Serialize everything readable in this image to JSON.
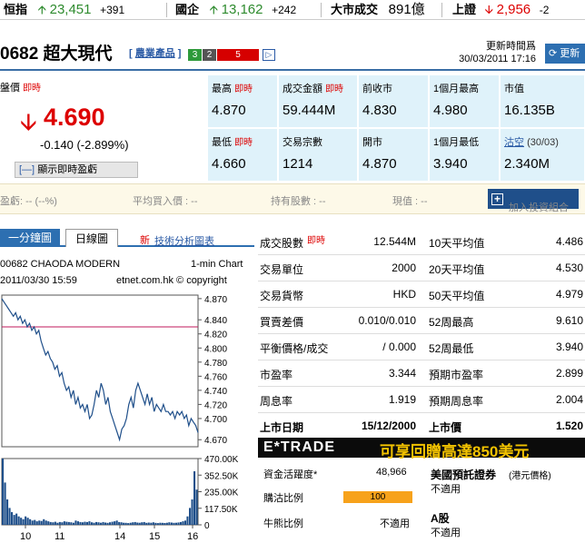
{
  "ticker": [
    {
      "name": "恒指",
      "value": "23,451",
      "change": "+391",
      "dir": "up"
    },
    {
      "name": "國企",
      "value": "13,162",
      "change": "+242",
      "dir": "up"
    },
    {
      "name": "大市成交",
      "value": "891億",
      "change": "",
      "dir": "none"
    },
    {
      "name": "上證",
      "value": "2,956",
      "change": "-2",
      "dir": "down"
    }
  ],
  "header": {
    "code_name": "0682 超大現代",
    "sector": "農業產品",
    "ratings": [
      "3",
      "2",
      "5"
    ],
    "rating_colors": [
      "#2e9a3a",
      "#555555",
      "#d60000"
    ],
    "update_label": "更新時間爲",
    "update_time": "30/03/2011 17:16",
    "refresh_label": "更新"
  },
  "quote": {
    "price_label": "盤價",
    "realtime": "即時",
    "price": "4.690",
    "change": "-0.140 (-2.899%)",
    "show_pnl": "顯示即時盈虧"
  },
  "cells": [
    {
      "label": "最高",
      "rt": "即時",
      "value": "4.870"
    },
    {
      "label": "成交金額",
      "rt": "即時",
      "value": "59.444M"
    },
    {
      "label": "前收市",
      "rt": "",
      "value": "4.830"
    },
    {
      "label": "1個月最高",
      "rt": "",
      "value": "4.980"
    },
    {
      "label": "市值",
      "rt": "",
      "value": "16.135B"
    },
    {
      "label": "最低",
      "rt": "即時",
      "value": "4.660"
    },
    {
      "label": "交易宗數",
      "rt": "",
      "value": "1214"
    },
    {
      "label": "開市",
      "rt": "",
      "value": "4.870"
    },
    {
      "label": "1個月最低",
      "rt": "",
      "value": "3.940"
    },
    {
      "label": "沽空",
      "rt": "(30/03)",
      "value": "2.340M"
    }
  ],
  "portfolio": {
    "pnl": "盈虧: -- (--%)",
    "avg": "平均買入價 : --",
    "shares": "持有股數 : --",
    "cash": "現值 : --",
    "add_label": "加入投資組合"
  },
  "chart": {
    "tab1": "一分鐘圖",
    "tab2": "日線圖",
    "new": "新",
    "analysis": "技術分析圖表",
    "title": "00682 CHAODA MODERN",
    "interval": "1-min Chart",
    "datetime": "2011/03/30 15:59",
    "copyright": "etnet.com.hk © copyright",
    "price_ticks": [
      "4.870",
      "4.840",
      "4.820",
      "4.800",
      "4.780",
      "4.760",
      "4.740",
      "4.720",
      "4.700",
      "4.670"
    ],
    "vol_ticks": [
      "470.00K",
      "352.50K",
      "235.00K",
      "117.50K",
      "0"
    ],
    "x_ticks": [
      "10",
      "11",
      "14",
      "15",
      "16"
    ]
  },
  "chart_data": {
    "type": "line",
    "x_ticks": [
      "10",
      "11",
      "14",
      "15",
      "16"
    ],
    "ylim": [
      4.66,
      4.875
    ],
    "ref_line": 4.83,
    "price": [
      4.87,
      4.865,
      4.86,
      4.855,
      4.85,
      4.845,
      4.85,
      4.84,
      4.845,
      4.835,
      4.84,
      4.83,
      4.835,
      4.825,
      4.83,
      4.82,
      4.825,
      4.81,
      4.8,
      4.79,
      4.795,
      4.785,
      4.78,
      4.77,
      4.775,
      4.76,
      4.765,
      4.75,
      4.74,
      4.745,
      4.73,
      4.74,
      4.72,
      4.73,
      4.715,
      4.72,
      4.71,
      4.72,
      4.7,
      4.705,
      4.72,
      4.74,
      4.73,
      4.75,
      4.74,
      4.72,
      4.73,
      4.71,
      4.7,
      4.69,
      4.68,
      4.67,
      4.685,
      4.69,
      4.7,
      4.72,
      4.73,
      4.715,
      4.74,
      4.75,
      4.74,
      4.73,
      4.72,
      4.735,
      4.72,
      4.73,
      4.71,
      4.72,
      4.715,
      4.71,
      4.72,
      4.71,
      4.71,
      4.705,
      4.71,
      4.7,
      4.71,
      4.705,
      4.71,
      4.7,
      4.705,
      4.69,
      4.7,
      4.695,
      4.69,
      4.68
    ],
    "volume": [
      470,
      300,
      180,
      120,
      90,
      70,
      80,
      60,
      50,
      40,
      60,
      50,
      40,
      30,
      35,
      25,
      30,
      28,
      40,
      30,
      25,
      20,
      18,
      22,
      15,
      20,
      18,
      25,
      22,
      20,
      18,
      15,
      30,
      25,
      20,
      18,
      22,
      20,
      25,
      18,
      15,
      20,
      18,
      15,
      20,
      16,
      14,
      18,
      22,
      25,
      30,
      20,
      18,
      15,
      14,
      12,
      15,
      18,
      20,
      16,
      15,
      18,
      20,
      14,
      16,
      15,
      18,
      14,
      12,
      15,
      14,
      13,
      15,
      18,
      16,
      14,
      15,
      17,
      20,
      25,
      30,
      60,
      120,
      180,
      380,
      250
    ]
  },
  "stats": [
    {
      "l": "成交股數",
      "rt": "即時",
      "v": "12.544M",
      "l2": "10天平均值",
      "v2": "4.486"
    },
    {
      "l": "交易單位",
      "rt": "",
      "v": "2000",
      "l2": "20天平均值",
      "v2": "4.530"
    },
    {
      "l": "交易貨幣",
      "rt": "",
      "v": "HKD",
      "l2": "50天平均值",
      "v2": "4.979"
    },
    {
      "l": "買賣差價",
      "rt": "",
      "v": "0.010/0.010",
      "l2": "52周最高",
      "v2": "9.610"
    },
    {
      "l": "平衡價格/成交",
      "rt": "",
      "v": "/ 0.000",
      "l2": "52周最低",
      "v2": "3.940"
    },
    {
      "l": "市盈率",
      "rt": "",
      "v": "3.344",
      "l2": "預期市盈率",
      "v2": "2.899"
    },
    {
      "l": "周息率",
      "rt": "",
      "v": "1.919",
      "l2": "預期周息率",
      "v2": "2.004"
    },
    {
      "l": "上市日期",
      "rt": "",
      "v": "15/12/2000",
      "l2": "上市價",
      "v2": "1.520"
    }
  ],
  "etrade": {
    "logo": "E*TRADE",
    "promo": "可享回贈高達850美元"
  },
  "bottom": {
    "capital_label": "資金活躍度*",
    "capital_value": "48,966",
    "buy_ratio_label": "購沽比例",
    "buy_ratio_value": "100",
    "bull_bear_label": "牛熊比例",
    "bull_bear_value": "不適用",
    "adr_label": "美國預託證券",
    "adr_note": "(港元價格)",
    "adr_value": "不適用",
    "a_label": "A股",
    "a_value": "不適用"
  }
}
